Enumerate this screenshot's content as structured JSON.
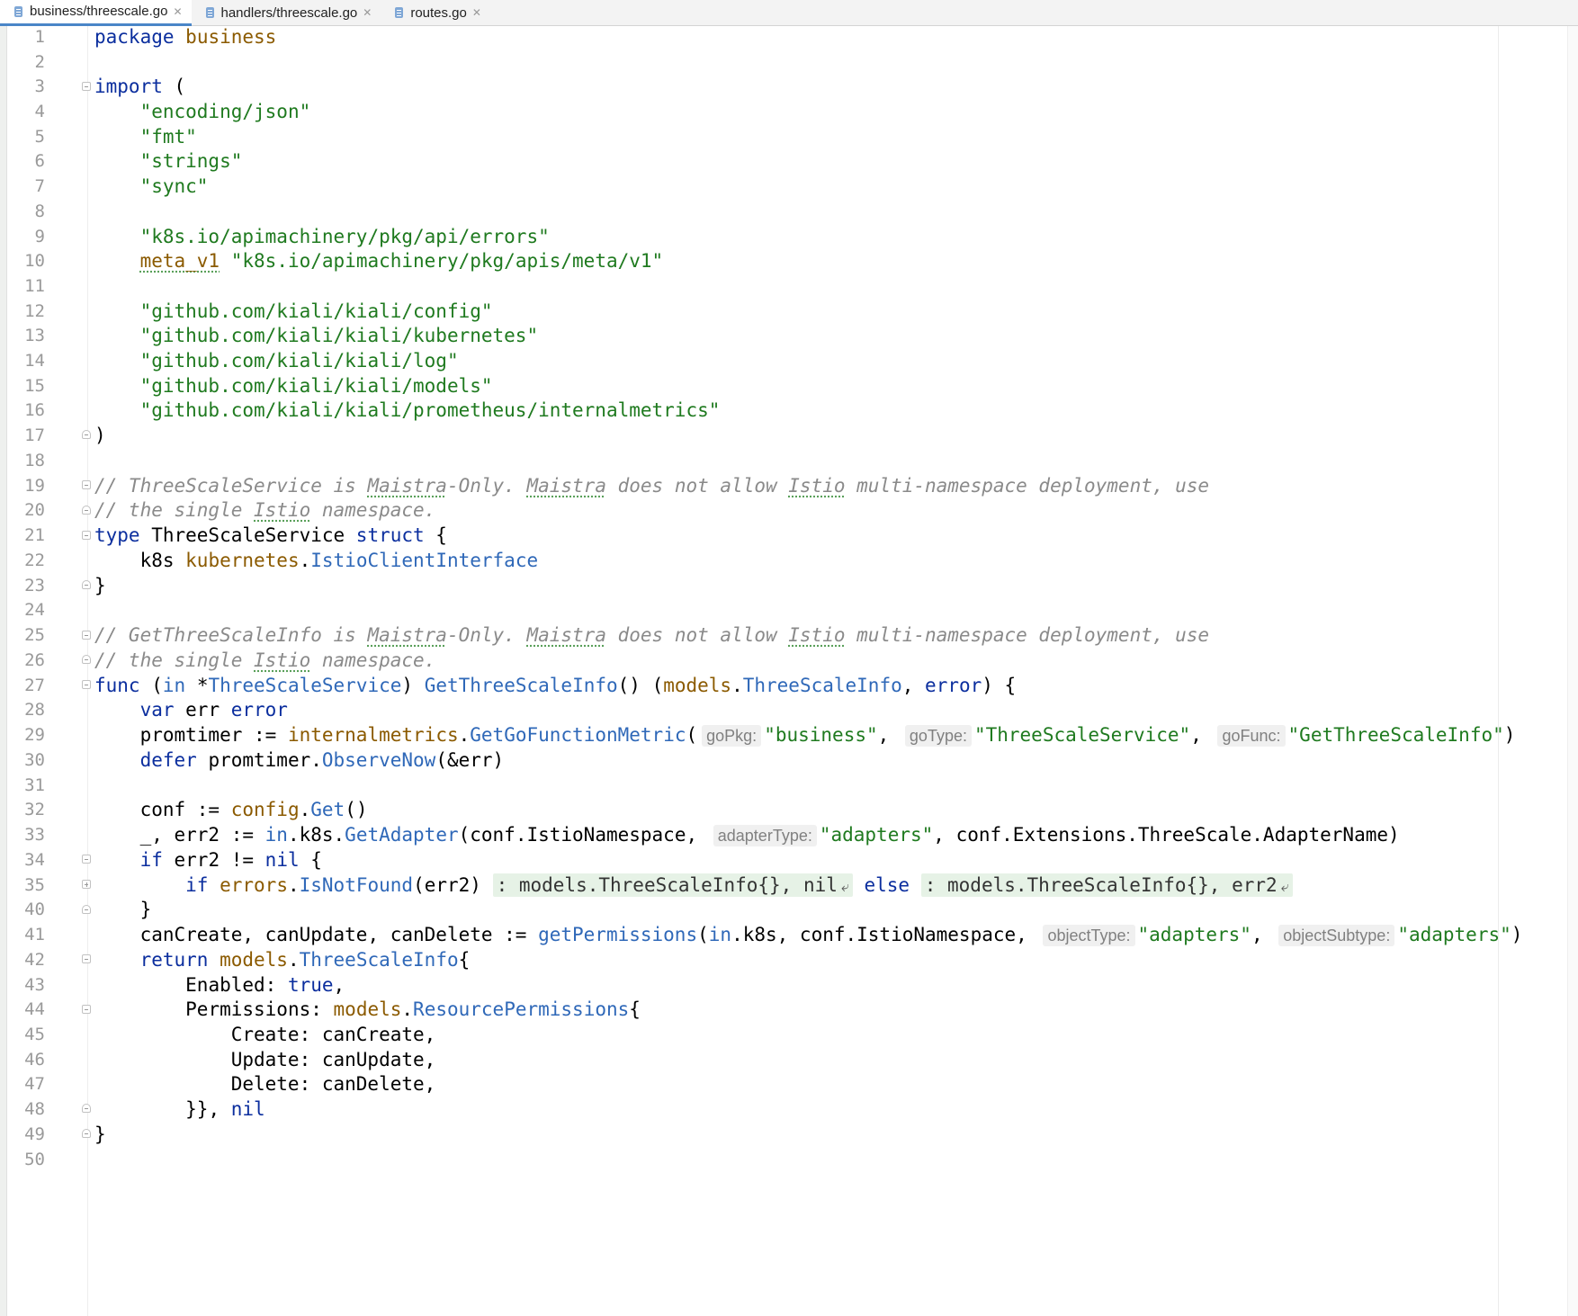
{
  "tabs": [
    {
      "label": "business/threescale.go",
      "active": true
    },
    {
      "label": "handlers/threescale.go",
      "active": false
    },
    {
      "label": "routes.go",
      "active": false
    }
  ],
  "line_numbers": [
    "1",
    "2",
    "3",
    "4",
    "5",
    "6",
    "7",
    "8",
    "9",
    "10",
    "11",
    "12",
    "13",
    "14",
    "15",
    "16",
    "17",
    "18",
    "19",
    "20",
    "21",
    "22",
    "23",
    "24",
    "25",
    "26",
    "27",
    "28",
    "29",
    "30",
    "31",
    "32",
    "33",
    "34",
    "35",
    "40",
    "41",
    "42",
    "43",
    "44",
    "45",
    "46",
    "47",
    "48",
    "49",
    "50"
  ],
  "code": {
    "package_kw": "package",
    "package_name": "business",
    "import_kw": "import",
    "import_open": " (",
    "imp_json": "\"encoding/json\"",
    "imp_fmt": "\"fmt\"",
    "imp_strings": "\"strings\"",
    "imp_sync": "\"sync\"",
    "imp_errors": "\"k8s.io/apimachinery/pkg/api/errors\"",
    "alias_meta": "meta_v1",
    "imp_meta": "\"k8s.io/apimachinery/pkg/apis/meta/v1\"",
    "imp_config": "\"github.com/kiali/kiali/config\"",
    "imp_kubernetes": "\"github.com/kiali/kiali/kubernetes\"",
    "imp_log": "\"github.com/kiali/kiali/log\"",
    "imp_models": "\"github.com/kiali/kiali/models\"",
    "imp_metrics": "\"github.com/kiali/kiali/prometheus/internalmetrics\"",
    "close_paren": ")",
    "c19_a": "// ThreeScaleService is ",
    "c19_maistra1": "Maistra",
    "c19_b": "-Only. ",
    "c19_maistra2": "Maistra",
    "c19_c": " does not allow ",
    "c19_istio": "Istio",
    "c19_d": " multi-namespace deployment, use",
    "c20_a": "// the single ",
    "c20_istio": "Istio",
    "c20_b": " namespace.",
    "type_kw": "type",
    "struct_name": " ThreeScaleService ",
    "struct_kw": "struct",
    "open_brace": " {",
    "field_k8s": "k8s ",
    "pkg_kubernetes": "kubernetes",
    "dot": ".",
    "iface": "IstioClientInterface",
    "close_brace": "}",
    "c25_a": "// GetThreeScaleInfo is ",
    "c25_maistra1": "Maistra",
    "c25_b": "-Only. ",
    "c25_maistra2": "Maistra",
    "c25_c": " does not allow ",
    "c25_istio": "Istio",
    "c25_d": " multi-namespace deployment, use",
    "c26_a": "// the single ",
    "c26_istio": "Istio",
    "c26_b": " namespace.",
    "func_kw": "func",
    "l27_a": " (",
    "in_kw": "in",
    "l27_star": " *",
    "recv_type": "ThreeScaleService",
    "l27_b": ") ",
    "fn_name": "GetThreeScaleInfo",
    "l27_c": "() (",
    "pkg_models": "models",
    "info_type": "ThreeScaleInfo",
    "l27_d": ", ",
    "error_kw": "error",
    "l27_e": ") {",
    "var_kw": "var",
    "l28_err": " err ",
    "l28_error": "error",
    "l29_a": "promtimer := ",
    "pkg_internalmetrics": "internalmetrics",
    "fn_getmetric": "GetGoFunctionMetric",
    "l29_paren": "(",
    "hint_gopkg": "goPkg:",
    "arg_business": "\"business\"",
    "comma_sp": ", ",
    "hint_gotype": "goType:",
    "arg_tss": "\"ThreeScaleService\"",
    "hint_gofunc": "goFunc:",
    "arg_gtsi": "\"GetThreeScaleInfo\"",
    "rparen": ")",
    "defer_kw": "defer",
    "l30_a": " promtimer.",
    "fn_observe": "ObserveNow",
    "l30_b": "(&err)",
    "l32_a": "conf := ",
    "pkg_config": "config",
    "fn_get": "Get",
    "l32_b": "()",
    "l33_a": "_, err2 := ",
    "l33_dot_k8s": ".k8s.",
    "fn_getadapter": "GetAdapter",
    "l33_b": "(conf.IstioNamespace, ",
    "hint_adaptertype": "adapterType:",
    "arg_adapters": "\"adapters\"",
    "l33_c": ", conf.Extensions.ThreeScale.AdapterName)",
    "if_kw": "if",
    "l34_a": " err2 != ",
    "nil_kw": "nil",
    "l34_b": " {",
    "pkg_errors": "errors",
    "fn_isnotfound": "IsNotFound",
    "l35_a": "(err2) ",
    "fold1": ": models.ThreeScaleInfo{}, nil",
    "fold_arrow": "⤶",
    "else_kw": "else",
    "fold2": ": models.ThreeScaleInfo{}, err2",
    "l41_a": "canCreate, canUpdate, canDelete := ",
    "fn_getperm": "getPermissions",
    "l41_b": "(",
    "l41_c": ".k8s, conf.IstioNamespace, ",
    "hint_objtype": "objectType:",
    "hint_objsubtype": "objectSubtype:",
    "return_kw": "return",
    "l42_open": "{",
    "l43_a": "Enabled: ",
    "true_kw": "true",
    "l43_b": ",",
    "l44_a": "Permissions: ",
    "res_perm": "ResourcePermissions",
    "l44_b": "{",
    "l45": "Create: canCreate,",
    "l46": "Update: canUpdate,",
    "l47": "Delete: canDelete,",
    "l48_a": "}}, "
  }
}
